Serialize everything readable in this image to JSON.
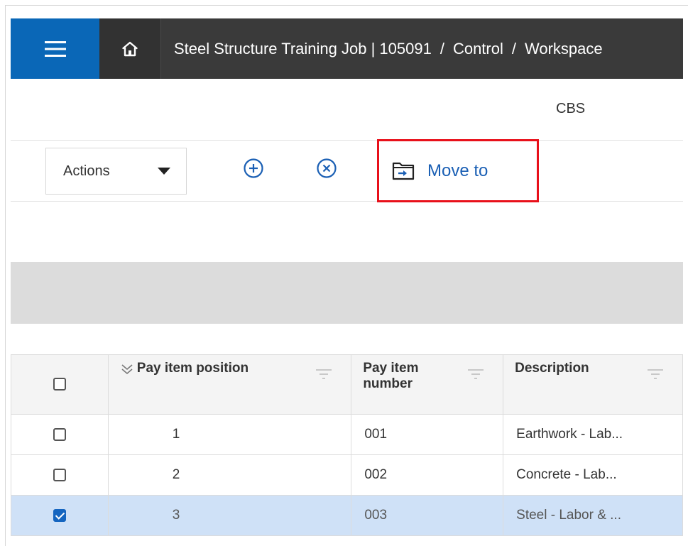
{
  "header": {
    "breadcrumb": [
      "Steel Structure Training Job | 105091",
      "Control",
      "Workspace"
    ],
    "separator": "/"
  },
  "icons": {
    "menu": "hamburger-menu-icon",
    "home": "home-icon",
    "add": "plus-circle-icon",
    "remove": "x-circle-icon",
    "move": "move-to-folder-icon",
    "sort": "chevron-double-down-icon",
    "filter": "filter-lines-icon"
  },
  "colors": {
    "menu_bg": "#0a67b7",
    "topbar_bg": "#3a3a3a",
    "accent": "#1a5fb4",
    "highlight_box": "#e8101a",
    "selected_row": "#cfe1f7"
  },
  "section": {
    "title": "CBS"
  },
  "toolbar": {
    "actions_label": "Actions",
    "move_label": "Move to"
  },
  "table": {
    "columns": [
      "Pay item position",
      "Pay item number",
      "Description"
    ],
    "rows": [
      {
        "position": "1",
        "number": "001",
        "description": "Earthwork - Lab...",
        "checked": false
      },
      {
        "position": "2",
        "number": "002",
        "description": "Concrete - Lab...",
        "checked": false
      },
      {
        "position": "3",
        "number": "003",
        "description": "Steel - Labor & ...",
        "checked": true
      }
    ]
  }
}
